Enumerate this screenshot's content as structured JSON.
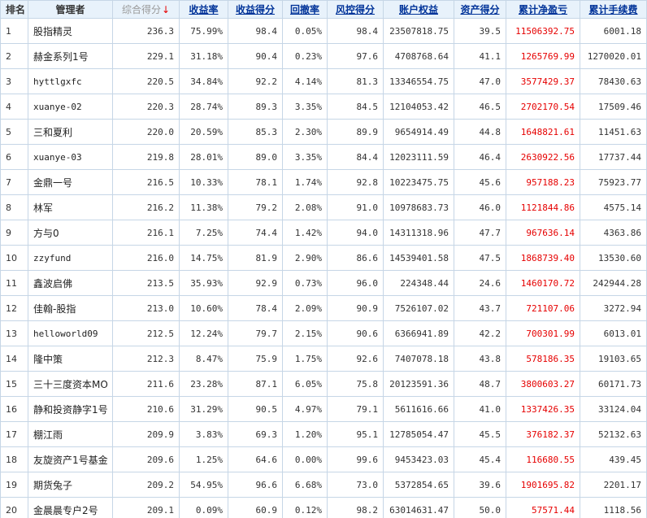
{
  "header": {
    "rank": "排名",
    "manager": "管理者",
    "score": "综合得分",
    "score_arrow": "↓",
    "return_rate": "收益率",
    "return_score": "收益得分",
    "drawdown": "回撤率",
    "risk_score": "风控得分",
    "equity": "账户权益",
    "asset_score": "资产得分",
    "net_profit": "累计净盈亏",
    "fees": "累计手续费"
  },
  "colors": {
    "header_bg": "#e8f2fb",
    "header_text": "#003399",
    "border": "#c6d6e6",
    "profit_red": "#e60000",
    "sort_arrow": "#e60000"
  },
  "rows": [
    {
      "rank": "1",
      "manager": "股指精灵",
      "score": "236.3",
      "return_rate": "75.99%",
      "return_score": "98.4",
      "drawdown": "0.05%",
      "risk_score": "98.4",
      "equity": "23507818.75",
      "asset_score": "39.5",
      "net_profit": "11506392.75",
      "fees": "6001.18"
    },
    {
      "rank": "2",
      "manager": "赫金系列1号",
      "score": "229.1",
      "return_rate": "31.18%",
      "return_score": "90.4",
      "drawdown": "0.23%",
      "risk_score": "97.6",
      "equity": "4708768.64",
      "asset_score": "41.1",
      "net_profit": "1265769.99",
      "fees": "1270020.01"
    },
    {
      "rank": "3",
      "manager": "hyttlgxfc",
      "score": "220.5",
      "return_rate": "34.84%",
      "return_score": "92.2",
      "drawdown": "4.14%",
      "risk_score": "81.3",
      "equity": "13346554.75",
      "asset_score": "47.0",
      "net_profit": "3577429.37",
      "fees": "78430.63"
    },
    {
      "rank": "4",
      "manager": "xuanye-02",
      "score": "220.3",
      "return_rate": "28.74%",
      "return_score": "89.3",
      "drawdown": "3.35%",
      "risk_score": "84.5",
      "equity": "12104053.42",
      "asset_score": "46.5",
      "net_profit": "2702170.54",
      "fees": "17509.46"
    },
    {
      "rank": "5",
      "manager": "三和夏利",
      "score": "220.0",
      "return_rate": "20.59%",
      "return_score": "85.3",
      "drawdown": "2.30%",
      "risk_score": "89.9",
      "equity": "9654914.49",
      "asset_score": "44.8",
      "net_profit": "1648821.61",
      "fees": "11451.63"
    },
    {
      "rank": "6",
      "manager": "xuanye-03",
      "score": "219.8",
      "return_rate": "28.01%",
      "return_score": "89.0",
      "drawdown": "3.35%",
      "risk_score": "84.4",
      "equity": "12023111.59",
      "asset_score": "46.4",
      "net_profit": "2630922.56",
      "fees": "17737.44"
    },
    {
      "rank": "7",
      "manager": "金鼎一号",
      "score": "216.5",
      "return_rate": "10.33%",
      "return_score": "78.1",
      "drawdown": "1.74%",
      "risk_score": "92.8",
      "equity": "10223475.75",
      "asset_score": "45.6",
      "net_profit": "957188.23",
      "fees": "75923.77"
    },
    {
      "rank": "8",
      "manager": "林军",
      "score": "216.2",
      "return_rate": "11.38%",
      "return_score": "79.2",
      "drawdown": "2.08%",
      "risk_score": "91.0",
      "equity": "10978683.73",
      "asset_score": "46.0",
      "net_profit": "1121844.86",
      "fees": "4575.14"
    },
    {
      "rank": "9",
      "manager": "方与0",
      "score": "216.1",
      "return_rate": "7.25%",
      "return_score": "74.4",
      "drawdown": "1.42%",
      "risk_score": "94.0",
      "equity": "14311318.96",
      "asset_score": "47.7",
      "net_profit": "967636.14",
      "fees": "4363.86"
    },
    {
      "rank": "10",
      "manager": "zzyfund",
      "score": "216.0",
      "return_rate": "14.75%",
      "return_score": "81.9",
      "drawdown": "2.90%",
      "risk_score": "86.6",
      "equity": "14539401.58",
      "asset_score": "47.5",
      "net_profit": "1868739.40",
      "fees": "13530.60"
    },
    {
      "rank": "11",
      "manager": "鑫波启佛",
      "score": "213.5",
      "return_rate": "35.93%",
      "return_score": "92.9",
      "drawdown": "0.73%",
      "risk_score": "96.0",
      "equity": "224348.44",
      "asset_score": "24.6",
      "net_profit": "1460170.72",
      "fees": "242944.28"
    },
    {
      "rank": "12",
      "manager": "佳翰-股指",
      "score": "213.0",
      "return_rate": "10.60%",
      "return_score": "78.4",
      "drawdown": "2.09%",
      "risk_score": "90.9",
      "equity": "7526107.02",
      "asset_score": "43.7",
      "net_profit": "721107.06",
      "fees": "3272.94"
    },
    {
      "rank": "13",
      "manager": "helloworld09",
      "score": "212.5",
      "return_rate": "12.24%",
      "return_score": "79.7",
      "drawdown": "2.15%",
      "risk_score": "90.6",
      "equity": "6366941.89",
      "asset_score": "42.2",
      "net_profit": "700301.99",
      "fees": "6013.01"
    },
    {
      "rank": "14",
      "manager": "隆中策",
      "score": "212.3",
      "return_rate": "8.47%",
      "return_score": "75.9",
      "drawdown": "1.75%",
      "risk_score": "92.6",
      "equity": "7407078.18",
      "asset_score": "43.8",
      "net_profit": "578186.35",
      "fees": "19103.65"
    },
    {
      "rank": "15",
      "manager": "三十三度资本MO",
      "score": "211.6",
      "return_rate": "23.28%",
      "return_score": "87.1",
      "drawdown": "6.05%",
      "risk_score": "75.8",
      "equity": "20123591.36",
      "asset_score": "48.7",
      "net_profit": "3800603.27",
      "fees": "60171.73"
    },
    {
      "rank": "16",
      "manager": "静和投资静字1号",
      "score": "210.6",
      "return_rate": "31.29%",
      "return_score": "90.5",
      "drawdown": "4.97%",
      "risk_score": "79.1",
      "equity": "5611616.66",
      "asset_score": "41.0",
      "net_profit": "1337426.35",
      "fees": "33124.04"
    },
    {
      "rank": "17",
      "manager": "棚江雨",
      "score": "209.9",
      "return_rate": "3.83%",
      "return_score": "69.3",
      "drawdown": "1.20%",
      "risk_score": "95.1",
      "equity": "12785054.47",
      "asset_score": "45.5",
      "net_profit": "376182.37",
      "fees": "52132.63"
    },
    {
      "rank": "18",
      "manager": "友旋资产1号基金",
      "score": "209.6",
      "return_rate": "1.25%",
      "return_score": "64.6",
      "drawdown": "0.00%",
      "risk_score": "99.6",
      "equity": "9453423.03",
      "asset_score": "45.4",
      "net_profit": "116680.55",
      "fees": "439.45"
    },
    {
      "rank": "19",
      "manager": "期货兔子",
      "score": "209.2",
      "return_rate": "54.95%",
      "return_score": "96.6",
      "drawdown": "6.68%",
      "risk_score": "73.0",
      "equity": "5372854.65",
      "asset_score": "39.6",
      "net_profit": "1901695.82",
      "fees": "2201.17"
    },
    {
      "rank": "20",
      "manager": "金晨晨专户2号",
      "score": "209.1",
      "return_rate": "0.09%",
      "return_score": "60.9",
      "drawdown": "0.12%",
      "risk_score": "98.2",
      "equity": "63014631.47",
      "asset_score": "50.0",
      "net_profit": "57571.44",
      "fees": "1118.56"
    }
  ]
}
